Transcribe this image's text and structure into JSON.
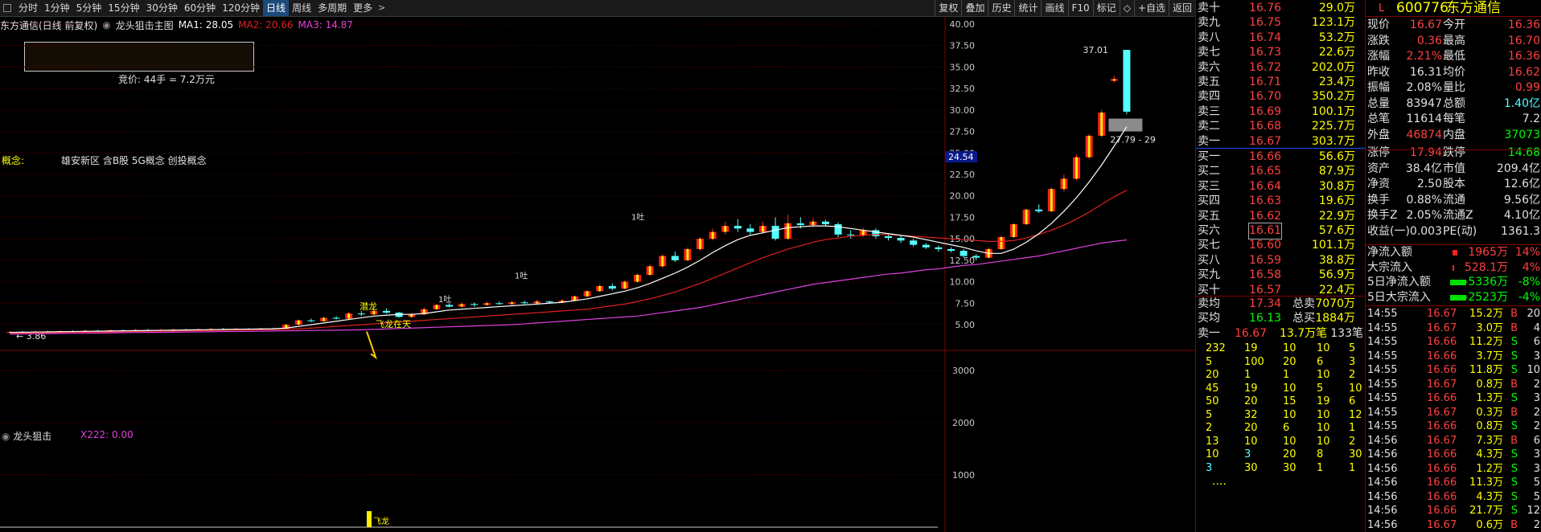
{
  "toolbar": {
    "periods": [
      "分时",
      "1分钟",
      "5分钟",
      "15分钟",
      "30分钟",
      "60分钟",
      "120分钟",
      "日线",
      "周线",
      "多周期",
      "更多"
    ],
    "active_period": "日线",
    "right_items": [
      "复权",
      "叠加",
      "历史",
      "统计",
      "画线",
      "F10",
      "标记",
      "◇",
      "+自选",
      "返回"
    ]
  },
  "indicator": {
    "title": "东方通信(日线 前复权)",
    "template": "龙头狙击主图",
    "ma1": "MA1: 28.05",
    "ma2": "MA2: 20.66",
    "ma3": "MA3: 14.87"
  },
  "auction": "竞价: 44手 = 7.2万元",
  "concept": {
    "label": "概念:",
    "value": "雄安新区 含B股 5G概念 创投概念"
  },
  "chart_data": {
    "type": "candlestick",
    "price_axis": [
      40.0,
      37.5,
      35.0,
      32.5,
      30.0,
      27.5,
      25.0,
      22.5,
      20.0,
      17.5,
      15.0,
      12.5,
      10.0,
      7.5,
      5.0
    ],
    "current_price_tag": "24.54",
    "high_label": "37.01",
    "low_label": "← 3.86",
    "range_label": "27.79 - 29",
    "signals": {
      "dive": "潜龙",
      "fly": "飞龙在天",
      "yi": "1吐"
    },
    "candles": [
      {
        "o": 4.1,
        "c": 4.15,
        "h": 4.3,
        "l": 4.0
      },
      {
        "o": 4.15,
        "c": 4.12,
        "h": 4.25,
        "l": 4.05
      },
      {
        "o": 4.1,
        "c": 4.2,
        "h": 4.3,
        "l": 4.05
      },
      {
        "o": 4.2,
        "c": 4.18,
        "h": 4.3,
        "l": 4.1
      },
      {
        "o": 4.18,
        "c": 4.25,
        "h": 4.35,
        "l": 4.1
      },
      {
        "o": 4.25,
        "c": 4.22,
        "h": 4.35,
        "l": 4.15
      },
      {
        "o": 4.22,
        "c": 4.3,
        "h": 4.4,
        "l": 4.18
      },
      {
        "o": 4.3,
        "c": 4.28,
        "h": 4.4,
        "l": 4.2
      },
      {
        "o": 4.28,
        "c": 4.35,
        "h": 4.45,
        "l": 4.25
      },
      {
        "o": 4.35,
        "c": 4.3,
        "h": 4.45,
        "l": 4.25
      },
      {
        "o": 4.3,
        "c": 4.38,
        "h": 4.5,
        "l": 4.28
      },
      {
        "o": 4.38,
        "c": 4.35,
        "h": 4.48,
        "l": 4.3
      },
      {
        "o": 4.35,
        "c": 4.4,
        "h": 4.5,
        "l": 4.3
      },
      {
        "o": 4.4,
        "c": 4.42,
        "h": 4.55,
        "l": 4.35
      },
      {
        "o": 4.42,
        "c": 4.4,
        "h": 4.52,
        "l": 4.35
      },
      {
        "o": 4.4,
        "c": 4.45,
        "h": 4.55,
        "l": 4.38
      },
      {
        "o": 4.45,
        "c": 4.5,
        "h": 4.6,
        "l": 4.4
      },
      {
        "o": 4.5,
        "c": 4.48,
        "h": 4.6,
        "l": 4.42
      },
      {
        "o": 4.48,
        "c": 4.52,
        "h": 4.62,
        "l": 4.45
      },
      {
        "o": 4.52,
        "c": 4.5,
        "h": 4.6,
        "l": 4.45
      },
      {
        "o": 4.5,
        "c": 4.55,
        "h": 4.65,
        "l": 4.45
      },
      {
        "o": 4.55,
        "c": 4.52,
        "h": 4.65,
        "l": 4.48
      },
      {
        "o": 4.52,
        "c": 5.0,
        "h": 5.1,
        "l": 4.5
      },
      {
        "o": 5.0,
        "c": 5.5,
        "h": 5.6,
        "l": 4.95
      },
      {
        "o": 5.5,
        "c": 5.4,
        "h": 5.7,
        "l": 5.3
      },
      {
        "o": 5.4,
        "c": 5.8,
        "h": 5.9,
        "l": 5.35
      },
      {
        "o": 5.8,
        "c": 5.7,
        "h": 6.0,
        "l": 5.6
      },
      {
        "o": 5.7,
        "c": 6.3,
        "h": 6.5,
        "l": 5.65
      },
      {
        "o": 6.3,
        "c": 6.2,
        "h": 6.6,
        "l": 6.0
      },
      {
        "o": 6.2,
        "c": 6.6,
        "h": 6.8,
        "l": 6.1
      },
      {
        "o": 6.6,
        "c": 6.4,
        "h": 6.9,
        "l": 6.3
      },
      {
        "o": 6.4,
        "c": 5.9,
        "h": 6.5,
        "l": 5.8
      },
      {
        "o": 5.9,
        "c": 6.2,
        "h": 6.4,
        "l": 5.8
      },
      {
        "o": 6.2,
        "c": 6.8,
        "h": 7.0,
        "l": 6.1
      },
      {
        "o": 6.8,
        "c": 7.3,
        "h": 7.4,
        "l": 6.7
      },
      {
        "o": 7.3,
        "c": 7.1,
        "h": 7.5,
        "l": 7.0
      },
      {
        "o": 7.1,
        "c": 7.4,
        "h": 7.6,
        "l": 7.0
      },
      {
        "o": 7.4,
        "c": 7.3,
        "h": 7.6,
        "l": 7.1
      },
      {
        "o": 7.3,
        "c": 7.5,
        "h": 7.7,
        "l": 7.2
      },
      {
        "o": 7.5,
        "c": 7.4,
        "h": 7.7,
        "l": 7.3
      },
      {
        "o": 7.4,
        "c": 7.6,
        "h": 7.8,
        "l": 7.3
      },
      {
        "o": 7.6,
        "c": 7.5,
        "h": 7.8,
        "l": 7.4
      },
      {
        "o": 7.5,
        "c": 7.7,
        "h": 7.9,
        "l": 7.4
      },
      {
        "o": 7.7,
        "c": 7.6,
        "h": 7.8,
        "l": 7.5
      },
      {
        "o": 7.6,
        "c": 7.8,
        "h": 8.0,
        "l": 7.5
      },
      {
        "o": 7.8,
        "c": 8.3,
        "h": 8.4,
        "l": 7.7
      },
      {
        "o": 8.3,
        "c": 8.9,
        "h": 9.0,
        "l": 8.2
      },
      {
        "o": 8.9,
        "c": 9.5,
        "h": 9.7,
        "l": 8.8
      },
      {
        "o": 9.5,
        "c": 9.2,
        "h": 9.8,
        "l": 9.0
      },
      {
        "o": 9.2,
        "c": 10.0,
        "h": 10.2,
        "l": 9.1
      },
      {
        "o": 10.0,
        "c": 10.8,
        "h": 11.0,
        "l": 9.9
      },
      {
        "o": 10.8,
        "c": 11.8,
        "h": 12.0,
        "l": 10.7
      },
      {
        "o": 11.8,
        "c": 13.0,
        "h": 13.2,
        "l": 11.6
      },
      {
        "o": 13.0,
        "c": 12.5,
        "h": 13.5,
        "l": 12.3
      },
      {
        "o": 12.5,
        "c": 13.8,
        "h": 14.0,
        "l": 12.4
      },
      {
        "o": 13.8,
        "c": 15.0,
        "h": 15.2,
        "l": 13.6
      },
      {
        "o": 15.0,
        "c": 15.8,
        "h": 16.2,
        "l": 14.8
      },
      {
        "o": 15.8,
        "c": 16.5,
        "h": 17.0,
        "l": 15.5
      },
      {
        "o": 16.5,
        "c": 16.2,
        "h": 17.3,
        "l": 15.8
      },
      {
        "o": 16.2,
        "c": 15.8,
        "h": 16.7,
        "l": 15.5
      },
      {
        "o": 15.8,
        "c": 16.5,
        "h": 17.0,
        "l": 15.6
      },
      {
        "o": 16.5,
        "c": 15.0,
        "h": 17.5,
        "l": 14.8
      },
      {
        "o": 15.0,
        "c": 16.8,
        "h": 17.8,
        "l": 14.9
      },
      {
        "o": 16.8,
        "c": 16.6,
        "h": 17.5,
        "l": 16.2
      },
      {
        "o": 16.6,
        "c": 17.0,
        "h": 17.4,
        "l": 16.3
      },
      {
        "o": 17.0,
        "c": 16.7,
        "h": 17.2,
        "l": 16.4
      },
      {
        "o": 16.7,
        "c": 15.5,
        "h": 16.9,
        "l": 15.2
      },
      {
        "o": 15.5,
        "c": 15.4,
        "h": 16.0,
        "l": 15.0
      },
      {
        "o": 15.4,
        "c": 16.0,
        "h": 16.3,
        "l": 15.2
      },
      {
        "o": 16.0,
        "c": 15.3,
        "h": 16.2,
        "l": 15.0
      },
      {
        "o": 15.3,
        "c": 15.1,
        "h": 15.5,
        "l": 14.8
      },
      {
        "o": 15.1,
        "c": 14.8,
        "h": 15.4,
        "l": 14.5
      },
      {
        "o": 14.8,
        "c": 14.3,
        "h": 15.0,
        "l": 14.1
      },
      {
        "o": 14.3,
        "c": 14.0,
        "h": 14.5,
        "l": 13.8
      },
      {
        "o": 14.0,
        "c": 13.8,
        "h": 14.2,
        "l": 13.5
      },
      {
        "o": 13.8,
        "c": 13.6,
        "h": 14.0,
        "l": 13.4
      },
      {
        "o": 13.6,
        "c": 13.0,
        "h": 13.8,
        "l": 12.8
      },
      {
        "o": 13.0,
        "c": 12.8,
        "h": 13.2,
        "l": 12.5
      },
      {
        "o": 12.8,
        "c": 13.8,
        "h": 14.0,
        "l": 12.7
      },
      {
        "o": 13.8,
        "c": 15.2,
        "h": 15.4,
        "l": 13.7
      },
      {
        "o": 15.2,
        "c": 16.7,
        "h": 16.8,
        "l": 15.1
      },
      {
        "o": 16.7,
        "c": 18.4,
        "h": 18.5,
        "l": 16.6
      },
      {
        "o": 18.4,
        "c": 18.2,
        "h": 19.0,
        "l": 18.0
      },
      {
        "o": 18.2,
        "c": 20.8,
        "h": 21.0,
        "l": 18.1
      },
      {
        "o": 20.8,
        "c": 22.0,
        "h": 22.5,
        "l": 20.5
      },
      {
        "o": 22.0,
        "c": 24.5,
        "h": 24.8,
        "l": 21.8
      },
      {
        "o": 24.5,
        "c": 27.0,
        "h": 27.2,
        "l": 24.3
      },
      {
        "o": 27.0,
        "c": 29.7,
        "h": 30.0,
        "l": 26.8
      },
      {
        "o": 33.4,
        "c": 33.6,
        "h": 34.0,
        "l": 33.2
      },
      {
        "o": 37.0,
        "c": 29.8,
        "h": 37.01,
        "l": 29.5
      }
    ],
    "ma1": [
      4.1,
      4.12,
      4.14,
      4.16,
      4.18,
      4.2,
      4.22,
      4.24,
      4.26,
      4.28,
      4.3,
      4.32,
      4.34,
      4.36,
      4.38,
      4.4,
      4.42,
      4.44,
      4.46,
      4.48,
      4.5,
      4.52,
      4.6,
      4.8,
      5.0,
      5.2,
      5.4,
      5.6,
      5.8,
      6.0,
      6.1,
      6.2,
      6.2,
      6.3,
      6.5,
      6.7,
      6.8,
      6.9,
      7.0,
      7.1,
      7.2,
      7.3,
      7.4,
      7.5,
      7.6,
      7.8,
      8.0,
      8.3,
      8.6,
      8.9,
      9.3,
      9.8,
      10.4,
      11.0,
      11.7,
      12.5,
      13.4,
      14.2,
      14.9,
      15.4,
      15.7,
      16.0,
      16.3,
      16.4,
      16.5,
      16.5,
      16.4,
      16.2,
      16.0,
      15.8,
      15.6,
      15.4,
      15.2,
      14.9,
      14.6,
      14.3,
      14.0,
      13.6,
      13.3,
      13.3,
      13.8,
      14.6,
      15.6,
      16.8,
      18.2,
      19.8,
      21.6,
      23.6,
      25.8,
      28.05
    ],
    "ma2": [
      4.0,
      4.02,
      4.04,
      4.06,
      4.08,
      4.1,
      4.12,
      4.14,
      4.16,
      4.18,
      4.2,
      4.22,
      4.24,
      4.26,
      4.28,
      4.3,
      4.32,
      4.34,
      4.36,
      4.38,
      4.4,
      4.42,
      4.46,
      4.52,
      4.6,
      4.7,
      4.8,
      4.9,
      5.0,
      5.1,
      5.2,
      5.3,
      5.4,
      5.5,
      5.6,
      5.7,
      5.8,
      5.9,
      6.0,
      6.1,
      6.2,
      6.3,
      6.4,
      6.5,
      6.6,
      6.7,
      6.8,
      7.0,
      7.2,
      7.4,
      7.7,
      8.0,
      8.4,
      8.8,
      9.3,
      9.8,
      10.4,
      11.0,
      11.6,
      12.2,
      12.8,
      13.3,
      13.8,
      14.2,
      14.6,
      14.9,
      15.1,
      15.3,
      15.4,
      15.5,
      15.5,
      15.4,
      15.3,
      15.2,
      15.1,
      15.0,
      14.9,
      14.8,
      14.7,
      14.7,
      14.8,
      15.1,
      15.5,
      16.0,
      16.6,
      17.3,
      18.1,
      19.0,
      19.9,
      20.66
    ],
    "ma3": [
      3.9,
      3.92,
      3.94,
      3.96,
      3.98,
      4.0,
      4.0,
      4.02,
      4.04,
      4.06,
      4.08,
      4.1,
      4.1,
      4.12,
      4.14,
      4.16,
      4.18,
      4.2,
      4.2,
      4.22,
      4.24,
      4.26,
      4.28,
      4.3,
      4.32,
      4.34,
      4.36,
      4.38,
      4.4,
      4.45,
      4.5,
      4.55,
      4.6,
      4.65,
      4.7,
      4.75,
      4.8,
      4.85,
      4.9,
      4.95,
      5.0,
      5.1,
      5.2,
      5.3,
      5.4,
      5.5,
      5.6,
      5.7,
      5.8,
      5.9,
      6.0,
      6.2,
      6.4,
      6.6,
      6.8,
      7.0,
      7.3,
      7.6,
      7.9,
      8.2,
      8.5,
      8.8,
      9.1,
      9.4,
      9.7,
      9.9,
      10.1,
      10.3,
      10.5,
      10.7,
      10.9,
      11.0,
      11.2,
      11.4,
      11.5,
      11.7,
      11.9,
      12.0,
      12.2,
      12.4,
      12.6,
      12.8,
      13.0,
      13.3,
      13.6,
      13.9,
      14.2,
      14.5,
      14.7,
      14.87
    ],
    "sub_axis": [
      3000,
      2000,
      1000
    ]
  },
  "sub": {
    "title": "龙头狙击",
    "x222": "X222: 0.00",
    "flag": "飞龙"
  },
  "orderbook": {
    "sells": [
      {
        "label": "卖十",
        "price": "16.76",
        "vol": "29.0万"
      },
      {
        "label": "卖九",
        "price": "16.75",
        "vol": "123.1万"
      },
      {
        "label": "卖八",
        "price": "16.74",
        "vol": "53.2万"
      },
      {
        "label": "卖七",
        "price": "16.73",
        "vol": "22.6万"
      },
      {
        "label": "卖六",
        "price": "16.72",
        "vol": "202.0万"
      },
      {
        "label": "卖五",
        "price": "16.71",
        "vol": "23.4万"
      },
      {
        "label": "卖四",
        "price": "16.70",
        "vol": "350.2万"
      },
      {
        "label": "卖三",
        "price": "16.69",
        "vol": "100.1万"
      },
      {
        "label": "卖二",
        "price": "16.68",
        "vol": "225.7万"
      },
      {
        "label": "卖一",
        "price": "16.67",
        "vol": "303.7万"
      }
    ],
    "buys": [
      {
        "label": "买一",
        "price": "16.66",
        "vol": "56.6万"
      },
      {
        "label": "买二",
        "price": "16.65",
        "vol": "87.9万"
      },
      {
        "label": "买三",
        "price": "16.64",
        "vol": "30.8万"
      },
      {
        "label": "买四",
        "price": "16.63",
        "vol": "19.6万"
      },
      {
        "label": "买五",
        "price": "16.62",
        "vol": "22.9万"
      },
      {
        "label": "买六",
        "price": "16.61",
        "vol": "57.6万"
      },
      {
        "label": "买七",
        "price": "16.60",
        "vol": "101.1万"
      },
      {
        "label": "买八",
        "price": "16.59",
        "vol": "38.8万"
      },
      {
        "label": "买九",
        "price": "16.58",
        "vol": "56.9万"
      },
      {
        "label": "买十",
        "price": "16.57",
        "vol": "22.4万"
      }
    ],
    "avg": [
      {
        "label": "卖均",
        "price": "17.34",
        "tl": "总卖",
        "tv": "7070万"
      },
      {
        "label": "买均",
        "price": "16.13",
        "tl": "总买",
        "tv": "1884万"
      }
    ],
    "queue_head": {
      "label": "卖一",
      "price": "16.67",
      "vol": "13.7万笔",
      "cnt": "133笔"
    },
    "queue": [
      [
        "232",
        "19",
        "10",
        "10",
        "5"
      ],
      [
        "5",
        "100",
        "20",
        "6",
        "3"
      ],
      [
        "20",
        "1",
        "1",
        "10",
        "2"
      ],
      [
        "45",
        "19",
        "10",
        "5",
        "10"
      ],
      [
        "50",
        "20",
        "15",
        "19",
        "6"
      ],
      [
        "5",
        "32",
        "10",
        "10",
        "12"
      ],
      [
        "2",
        "20",
        "6",
        "10",
        "1"
      ],
      [
        "13",
        "10",
        "10",
        "10",
        "2"
      ],
      [
        "10",
        "3",
        "20",
        "8",
        "30"
      ],
      [
        "3",
        "30",
        "30",
        "1",
        "1"
      ]
    ],
    "more": "...."
  },
  "quote": {
    "code": "600776",
    "name": "东方通信",
    "rows": [
      [
        "现价",
        "16.67",
        "今开",
        "16.36"
      ],
      [
        "涨跌",
        "0.36",
        "最高",
        "16.70"
      ],
      [
        "涨幅",
        "2.21%",
        "最低",
        "16.36"
      ],
      [
        "昨收",
        "16.31",
        "均价",
        "16.62"
      ],
      [
        "振幅",
        "2.08%",
        "量比",
        "0.99"
      ],
      [
        "总量",
        "83947",
        "总额",
        "1.40亿"
      ],
      [
        "总笔",
        "11614",
        "每笔",
        "7.2"
      ],
      [
        "外盘",
        "46874",
        "内盘",
        "37073"
      ],
      [
        "涨停",
        "17.94",
        "跌停",
        "14.68"
      ],
      [
        "资产",
        "38.4亿",
        "市值",
        "209.4亿"
      ],
      [
        "净资",
        "2.50",
        "股本",
        "12.6亿"
      ],
      [
        "换手",
        "0.88%",
        "流通",
        "9.56亿"
      ],
      [
        "换手Z",
        "2.05%",
        "流通Z",
        "4.10亿"
      ],
      [
        "收益(一)",
        "0.003",
        "PE(动)",
        "1361.3"
      ]
    ],
    "flows": [
      [
        "净流入额",
        "1965万",
        "14%"
      ],
      [
        "大宗流入",
        "528.1万",
        "4%"
      ],
      [
        "5日净流入额",
        "-5336万",
        "-8%"
      ],
      [
        "5日大宗流入",
        "-2523万",
        "-4%"
      ]
    ],
    "ticks": [
      [
        "14:55",
        "16.67",
        "15.2万",
        "B",
        "20"
      ],
      [
        "14:55",
        "16.67",
        "3.0万",
        "B",
        "4"
      ],
      [
        "14:55",
        "16.66",
        "11.2万",
        "S",
        "6"
      ],
      [
        "14:55",
        "16.66",
        "3.7万",
        "S",
        "3"
      ],
      [
        "14:55",
        "16.66",
        "11.8万",
        "S",
        "10"
      ],
      [
        "14:55",
        "16.67",
        "0.8万",
        "B",
        "2"
      ],
      [
        "14:55",
        "16.66",
        "1.3万",
        "S",
        "3"
      ],
      [
        "14:55",
        "16.67",
        "0.3万",
        "B",
        "2"
      ],
      [
        "14:55",
        "16.66",
        "0.8万",
        "S",
        "2"
      ],
      [
        "14:56",
        "16.67",
        "7.3万",
        "B",
        "6"
      ],
      [
        "14:56",
        "16.66",
        "4.3万",
        "S",
        "3"
      ],
      [
        "14:56",
        "16.66",
        "1.2万",
        "S",
        "3"
      ],
      [
        "14:56",
        "16.66",
        "11.3万",
        "S",
        "5"
      ],
      [
        "14:56",
        "16.66",
        "4.3万",
        "S",
        "5"
      ],
      [
        "14:56",
        "16.66",
        "21.7万",
        "S",
        "12"
      ],
      [
        "14:56",
        "16.67",
        "0.6万",
        "B",
        "2"
      ]
    ]
  }
}
